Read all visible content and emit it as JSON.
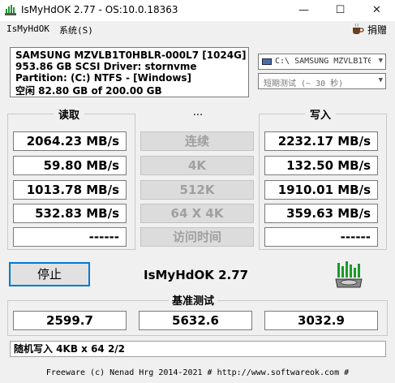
{
  "window": {
    "title": "IsMyHdOK 2.77 - OS:10.0.18363",
    "minimize": "—",
    "maximize": "☐",
    "close": "✕"
  },
  "menu": {
    "app": "IsMyHdOK",
    "system": "系统(S)",
    "donate": "捐赠"
  },
  "drive_info": {
    "model": "SAMSUNG MZVLB1T0HBLR-000L7 [1024G]",
    "size_driver": "953.86 GB  SCSI Driver: stornvme",
    "partition": "Partition: (C:) NTFS - [Windows]",
    "free": "空闲 82.80 GB of 200.00 GB"
  },
  "selects": {
    "drive": "C:\\ SAMSUNG MZVLB1T0",
    "duration": "短期测试 (~ 30 秒)"
  },
  "columns": {
    "read": "读取",
    "middle": "...",
    "write": "写入"
  },
  "modes": [
    "连续",
    "4K",
    "512K",
    "64 X 4K",
    "访问时间"
  ],
  "read_values": [
    "2064.23 MB/s",
    "59.80 MB/s",
    "1013.78 MB/s",
    "532.83 MB/s",
    "------"
  ],
  "write_values": [
    "2232.17 MB/s",
    "132.50 MB/s",
    "1910.01 MB/s",
    "359.63 MB/s",
    "------"
  ],
  "controls": {
    "stop": "停止",
    "version": "IsMyHdOK 2.77"
  },
  "benchmark": {
    "title": "基准测试",
    "values": [
      "2599.7",
      "5632.6",
      "3032.9"
    ]
  },
  "status": "随机写入 4KB x 64 2/2",
  "footer": "Freeware (c) Nenad Hrg 2014-2021 # http://www.softwareok.com   #",
  "colors": {
    "accent": "#0078d7",
    "icon_green": "#1a9a2a"
  }
}
